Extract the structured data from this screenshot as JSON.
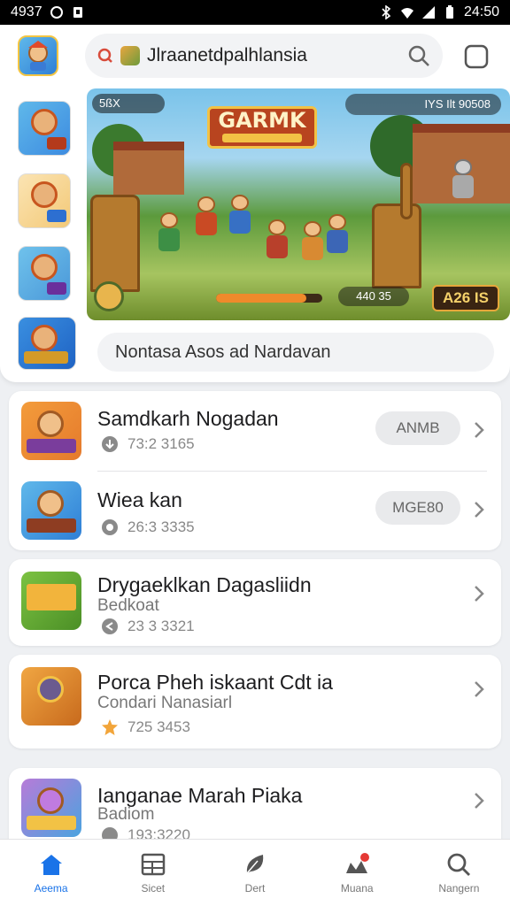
{
  "status_bar": {
    "time_left": "4937",
    "time_right": "24:50"
  },
  "search": {
    "value": "Jlraanetdpalhlansia",
    "icon": "search-icon"
  },
  "banner": {
    "title": "GARMK",
    "hud_left": "5ßX",
    "hud_right": "IYS  Ilt  90508",
    "hud_bottom": "440 35",
    "gold_button": "A26 IS",
    "progress": 0.85
  },
  "promo": {
    "text": "Nontasa Asos ad Nardavan"
  },
  "lists": [
    {
      "rows": [
        {
          "title": "Samdkarh Nogadan",
          "meta": "73:2 3165",
          "button": "ANMB",
          "icon_color": "#e57a2c"
        },
        {
          "title": "Wiea kan",
          "meta": "26:3 3335",
          "button": "MGE80",
          "icon_color": "#4aa3df"
        }
      ]
    },
    {
      "rows": [
        {
          "title": "Drygaeklkan Dagasliidn",
          "subtitle": "Bedkoat",
          "meta": "23 3 3321",
          "icon_color": "#6ab04c"
        }
      ]
    },
    {
      "rows": [
        {
          "title": "Porca Pheh iskaant Cdt ia",
          "subtitle": "Condari Nanasiarl",
          "meta": "725 3453",
          "icon_color": "#3b7fbf"
        }
      ]
    },
    {
      "rows": [
        {
          "title": "Ianganae Marah Piaka",
          "subtitle": "Badiom",
          "meta": "193:3220",
          "icon_color": "#9b59b6"
        }
      ]
    }
  ],
  "nav": [
    {
      "label": "Aeema",
      "icon": "home-icon",
      "active": true
    },
    {
      "label": "Sicet",
      "icon": "grid-icon",
      "active": false
    },
    {
      "label": "Dert",
      "icon": "leaf-icon",
      "active": false
    },
    {
      "label": "Muana",
      "icon": "notification-icon",
      "active": false
    },
    {
      "label": "Nangern",
      "icon": "search-icon",
      "active": false
    }
  ],
  "colors": {
    "accent": "#1a73e8",
    "banner_title_bg": "#b8441f",
    "gold": "#e6a73a"
  }
}
